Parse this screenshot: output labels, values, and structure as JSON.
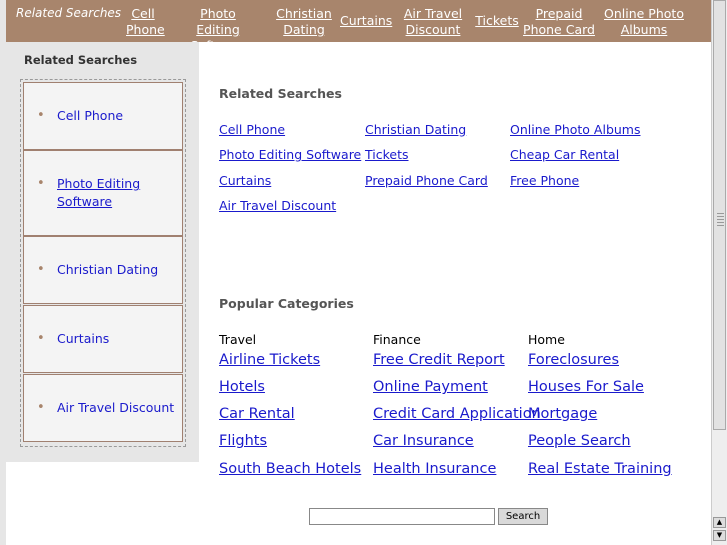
{
  "topnav": {
    "label": "Related Searches",
    "links": [
      "Cell Phone",
      "Photo Editing Software",
      "Christian Dating",
      "Curtains",
      "Air Travel Discount",
      "Tickets",
      "Prepaid Phone Card",
      "Online Photo Albums"
    ]
  },
  "sidebar": {
    "title": "Related Searches",
    "items": [
      "Cell Phone",
      "Photo Editing Software",
      "Christian Dating",
      "Curtains",
      "Air Travel Discount"
    ]
  },
  "related": {
    "title": "Related Searches",
    "links": [
      "Cell Phone",
      "Christian Dating",
      "Online Photo Albums",
      "Photo Editing Software",
      "Tickets",
      "Cheap Car Rental",
      "Curtains",
      "Prepaid Phone Card",
      "Free Phone",
      "Air Travel Discount"
    ]
  },
  "popular": {
    "title": "Popular Categories",
    "columns": [
      {
        "heading": "Travel",
        "links": [
          "Airline Tickets",
          "Hotels",
          "Car Rental",
          "Flights",
          "South Beach Hotels"
        ]
      },
      {
        "heading": "Finance",
        "links": [
          "Free Credit Report",
          "Online Payment",
          "Credit Card Application",
          "Car Insurance",
          "Health Insurance"
        ]
      },
      {
        "heading": "Home",
        "links": [
          "Foreclosures",
          "Houses For Sale",
          "Mortgage",
          "People Search",
          "Real Estate Training"
        ]
      }
    ]
  },
  "search": {
    "value": "",
    "button_label": "Search"
  },
  "colors": {
    "nav_bg": "#a8856c",
    "link": "#1a1acc",
    "sidebar_bg": "#e6e6e6"
  }
}
